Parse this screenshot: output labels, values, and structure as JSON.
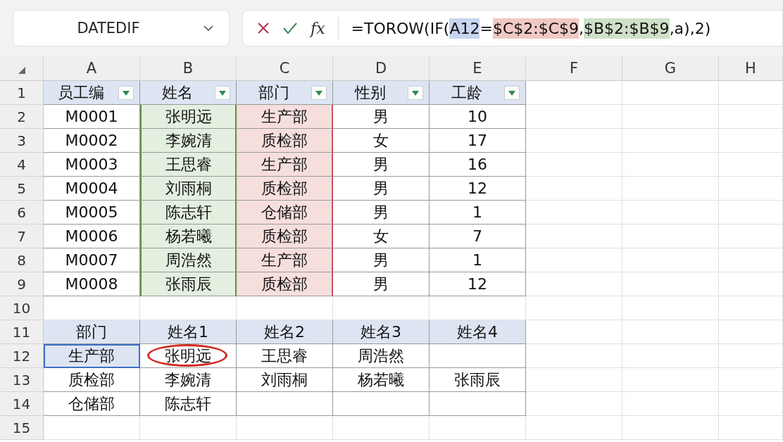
{
  "name_box": {
    "value": "DATEDIF"
  },
  "formula_bar": {
    "function_label": "fx",
    "segments": [
      {
        "text": "=TOROW(IF("
      },
      {
        "text": "A12",
        "color": "#c8d5ef"
      },
      {
        "text": "="
      },
      {
        "text": "$C$2:$C$9",
        "color": "#f0c9c4"
      },
      {
        "text": ","
      },
      {
        "text": "$B$2:$B$9",
        "color": "#cfe0c8"
      },
      {
        "text": ",a),2)"
      }
    ]
  },
  "sheet": {
    "columns": [
      "A",
      "B",
      "C",
      "D",
      "E",
      "F",
      "G",
      "H"
    ],
    "rows": [
      {
        "number": "1",
        "cells": [
          {
            "text": "员工编",
            "kind": "header",
            "filter": true
          },
          {
            "text": "姓名",
            "kind": "header",
            "filter": true
          },
          {
            "text": "部门",
            "kind": "header",
            "filter": true
          },
          {
            "text": "性别",
            "kind": "header",
            "filter": true
          },
          {
            "text": "工龄",
            "kind": "header",
            "filter": true
          }
        ]
      },
      {
        "number": "2",
        "cells": [
          {
            "text": "M0001"
          },
          {
            "text": "张明远",
            "kind": "green"
          },
          {
            "text": "生产部",
            "kind": "red"
          },
          {
            "text": "男"
          },
          {
            "text": "10"
          }
        ]
      },
      {
        "number": "3",
        "cells": [
          {
            "text": "M0002"
          },
          {
            "text": "李婉清",
            "kind": "green"
          },
          {
            "text": "质检部",
            "kind": "red"
          },
          {
            "text": "女"
          },
          {
            "text": "17"
          }
        ]
      },
      {
        "number": "4",
        "cells": [
          {
            "text": "M0003"
          },
          {
            "text": "王思睿",
            "kind": "green"
          },
          {
            "text": "生产部",
            "kind": "red"
          },
          {
            "text": "男"
          },
          {
            "text": "16"
          }
        ]
      },
      {
        "number": "5",
        "cells": [
          {
            "text": "M0004"
          },
          {
            "text": "刘雨桐",
            "kind": "green"
          },
          {
            "text": "质检部",
            "kind": "red"
          },
          {
            "text": "男"
          },
          {
            "text": "12"
          }
        ]
      },
      {
        "number": "6",
        "cells": [
          {
            "text": "M0005"
          },
          {
            "text": "陈志轩",
            "kind": "green"
          },
          {
            "text": "仓储部",
            "kind": "red"
          },
          {
            "text": "男"
          },
          {
            "text": "1"
          }
        ]
      },
      {
        "number": "7",
        "cells": [
          {
            "text": "M0006"
          },
          {
            "text": "杨若曦",
            "kind": "green"
          },
          {
            "text": "质检部",
            "kind": "red"
          },
          {
            "text": "女"
          },
          {
            "text": "7"
          }
        ]
      },
      {
        "number": "8",
        "cells": [
          {
            "text": "M0007"
          },
          {
            "text": "周浩然",
            "kind": "green"
          },
          {
            "text": "生产部",
            "kind": "red"
          },
          {
            "text": "男"
          },
          {
            "text": "1"
          }
        ]
      },
      {
        "number": "9",
        "cells": [
          {
            "text": "M0008"
          },
          {
            "text": "张雨辰",
            "kind": "green"
          },
          {
            "text": "质检部",
            "kind": "red"
          },
          {
            "text": "男"
          },
          {
            "text": "12"
          }
        ]
      },
      {
        "number": "10"
      },
      {
        "number": "11",
        "cells": [
          {
            "text": "部门",
            "kind": "header"
          },
          {
            "text": "姓名1",
            "kind": "header"
          },
          {
            "text": "姓名2",
            "kind": "header"
          },
          {
            "text": "姓名3",
            "kind": "header"
          },
          {
            "text": "姓名4",
            "kind": "header"
          }
        ]
      },
      {
        "number": "12",
        "cells": [
          {
            "text": "生产部",
            "kind": "selected"
          },
          {
            "text": "张明远",
            "circled": true
          },
          {
            "text": "王思睿"
          },
          {
            "text": "周浩然"
          }
        ]
      },
      {
        "number": "13",
        "cells": [
          {
            "text": "质检部"
          },
          {
            "text": "李婉清"
          },
          {
            "text": "刘雨桐"
          },
          {
            "text": "杨若曦"
          },
          {
            "text": "张雨辰"
          }
        ]
      },
      {
        "number": "14",
        "cells": [
          {
            "text": "仓储部"
          },
          {
            "text": "陈志轩"
          }
        ]
      },
      {
        "number": "15"
      }
    ]
  }
}
